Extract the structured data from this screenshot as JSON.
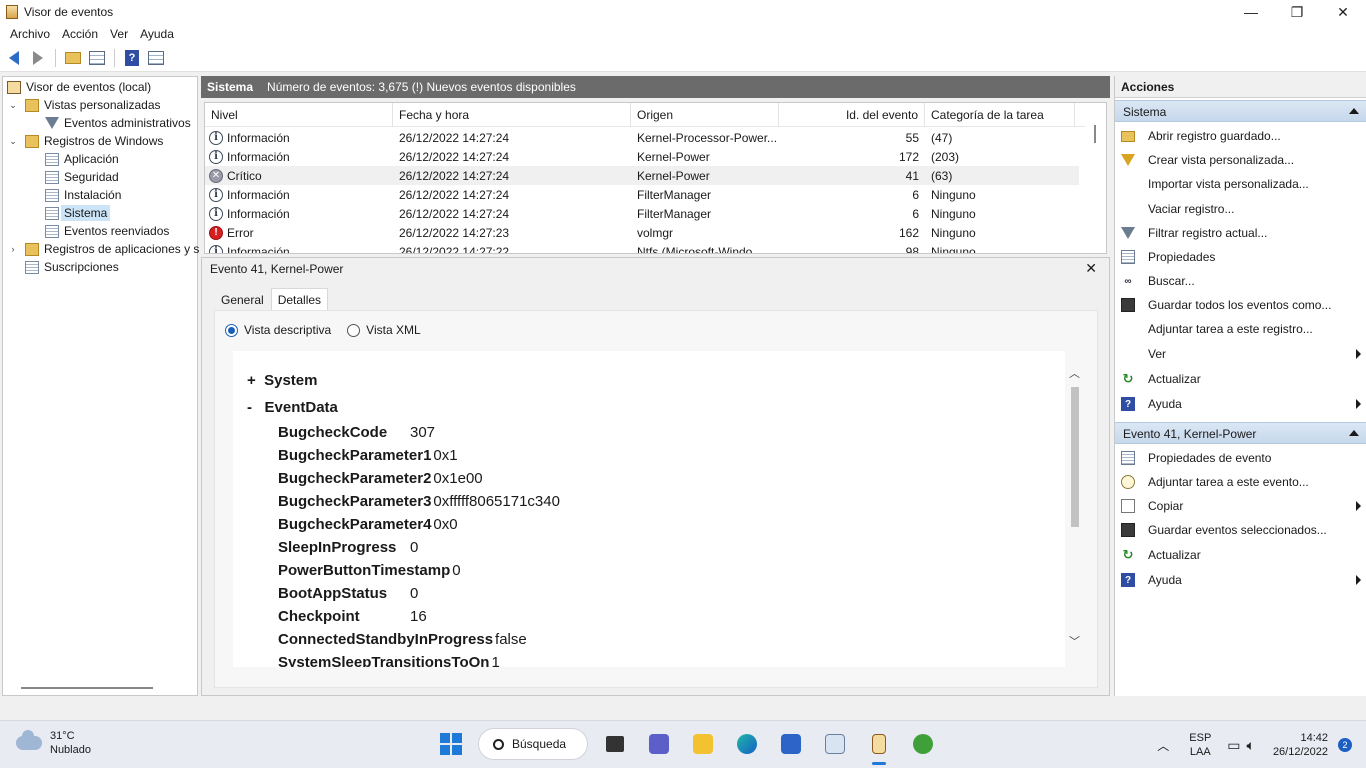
{
  "window": {
    "title": "Visor de eventos",
    "minimize": "—",
    "maximize": "❐",
    "close": "✕"
  },
  "menu": [
    "Archivo",
    "Acción",
    "Ver",
    "Ayuda"
  ],
  "tree": {
    "root": "Visor de eventos (local)",
    "custom_views": "Vistas personalizadas",
    "admin_events": "Eventos administrativos",
    "windows_logs": "Registros de Windows",
    "application": "Aplicación",
    "security": "Seguridad",
    "setup": "Instalación",
    "system": "Sistema",
    "forwarded": "Eventos reenviados",
    "app_services": "Registros de aplicaciones y s",
    "subscriptions": "Suscripciones"
  },
  "center": {
    "log_name": "Sistema",
    "event_count": "Número de eventos: 3,675 (!) Nuevos eventos disponibles"
  },
  "columns": [
    "Nivel",
    "Fecha y hora",
    "Origen",
    "Id. del evento",
    "Categoría de la tarea"
  ],
  "events": [
    {
      "level": "Información",
      "level_icon": "info-icon",
      "date": "26/12/2022 14:27:24",
      "source": "Kernel-Processor-Power...",
      "id": "55",
      "category": "(47)"
    },
    {
      "level": "Información",
      "level_icon": "info-icon",
      "date": "26/12/2022 14:27:24",
      "source": "Kernel-Power",
      "id": "172",
      "category": "(203)"
    },
    {
      "level": "Crítico",
      "level_icon": "critical-icon",
      "date": "26/12/2022 14:27:24",
      "source": "Kernel-Power",
      "id": "41",
      "category": "(63)"
    },
    {
      "level": "Información",
      "level_icon": "info-icon",
      "date": "26/12/2022 14:27:24",
      "source": "FilterManager",
      "id": "6",
      "category": "Ninguno"
    },
    {
      "level": "Información",
      "level_icon": "info-icon",
      "date": "26/12/2022 14:27:24",
      "source": "FilterManager",
      "id": "6",
      "category": "Ninguno"
    },
    {
      "level": "Error",
      "level_icon": "error-icon",
      "date": "26/12/2022 14:27:23",
      "source": "volmgr",
      "id": "162",
      "category": "Ninguno"
    },
    {
      "level": "Información",
      "level_icon": "info-icon",
      "date": "26/12/2022 14:27:22",
      "source": "Ntfs (Microsoft-Windo...",
      "id": "98",
      "category": "Ninguno"
    }
  ],
  "detail": {
    "title": "Evento 41, Kernel-Power",
    "close": "✕",
    "tabs": [
      "General",
      "Detalles"
    ],
    "radio_friendly": "Vista descriptiva",
    "radio_xml": "Vista XML",
    "system_section": "System",
    "system_toggle": "+",
    "eventdata_section": "EventData",
    "eventdata_toggle": "-",
    "fields": [
      {
        "key": "BugcheckCode",
        "value": "307"
      },
      {
        "key": "BugcheckParameter1",
        "value": "0x1"
      },
      {
        "key": "BugcheckParameter2",
        "value": "0x1e00"
      },
      {
        "key": "BugcheckParameter3",
        "value": "0xfffff8065171c340"
      },
      {
        "key": "BugcheckParameter4",
        "value": "0x0"
      },
      {
        "key": "SleepInProgress",
        "value": "0"
      },
      {
        "key": "PowerButtonTimestamp",
        "value": "0"
      },
      {
        "key": "BootAppStatus",
        "value": "0"
      },
      {
        "key": "Checkpoint",
        "value": "16"
      },
      {
        "key": "ConnectedStandbyInProgress",
        "value": "false"
      },
      {
        "key": "SystemSleepTransitionsToOn",
        "value": "1"
      }
    ]
  },
  "actions": {
    "title": "Acciones",
    "group1": "Sistema",
    "group1_items": [
      {
        "label": "Abrir registro guardado...",
        "icon": "open-folder-icon"
      },
      {
        "label": "Crear vista personalizada...",
        "icon": "create-view-icon"
      },
      {
        "label": "Importar vista personalizada...",
        "icon": ""
      },
      {
        "label": "Vaciar registro...",
        "icon": ""
      },
      {
        "label": "Filtrar registro actual...",
        "icon": "filter-icon"
      },
      {
        "label": "Propiedades",
        "icon": "properties-icon"
      },
      {
        "label": "Buscar...",
        "icon": "find-icon"
      },
      {
        "label": "Guardar todos los eventos como...",
        "icon": "save-icon"
      },
      {
        "label": "Adjuntar tarea a este registro...",
        "icon": ""
      },
      {
        "label": "Ver",
        "icon": ""
      },
      {
        "label": "Actualizar",
        "icon": "refresh-icon"
      },
      {
        "label": "Ayuda",
        "icon": "help-icon"
      }
    ],
    "group2": "Evento 41, Kernel-Power",
    "group2_items": [
      {
        "label": "Propiedades de evento",
        "icon": "properties-icon"
      },
      {
        "label": "Adjuntar tarea a este evento...",
        "icon": "task-icon"
      },
      {
        "label": "Copiar",
        "icon": "copy-icon"
      },
      {
        "label": "Guardar eventos seleccionados...",
        "icon": "save-icon"
      },
      {
        "label": "Actualizar",
        "icon": "refresh-icon"
      },
      {
        "label": "Ayuda",
        "icon": "help-icon"
      }
    ]
  },
  "taskbar": {
    "temperature": "31°C",
    "weather": "Nublado",
    "search": "Búsqueda",
    "lang_top": "ESP",
    "lang_bottom": "LAA",
    "time": "14:42",
    "date": "26/12/2022",
    "notifications": "2"
  }
}
